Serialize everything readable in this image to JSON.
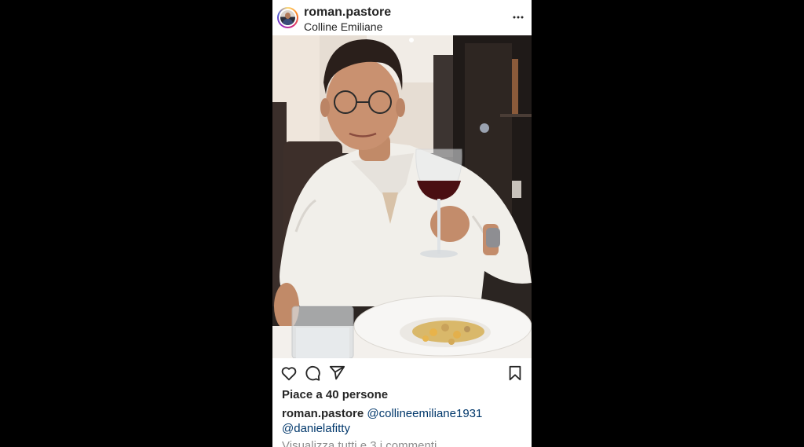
{
  "post": {
    "username": "roman.pastore",
    "location": "Colline Emiliane",
    "likes_text": "Piace a 40 persone",
    "caption": {
      "username": "roman.pastore",
      "mention_1": "@collineemiliane1931",
      "mention_2": "@danielafitty"
    },
    "view_comments": "Visualizza tutti e 3 i commenti",
    "icons": {
      "more": "more-options-icon",
      "like": "heart-icon",
      "comment": "comment-bubble-icon",
      "share": "paper-plane-icon",
      "save": "bookmark-icon"
    }
  },
  "colors": {
    "background": "#000000",
    "card": "#ffffff",
    "text": "#262626",
    "mention": "#00376b",
    "muted": "#8e8e8e"
  }
}
